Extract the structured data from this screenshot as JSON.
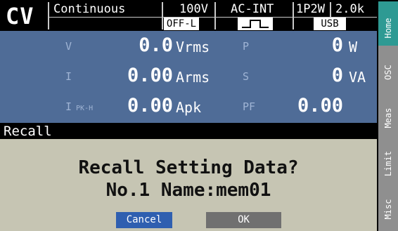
{
  "status_bar": {
    "mode": "CV",
    "operation": "Continuous",
    "range": "100V",
    "signal_source": "AC-INT",
    "phase_wire": "1P2W",
    "current_range": "2.0k",
    "output": "OFF-L",
    "waveform_icon": "square-wave-icon",
    "interface": "USB"
  },
  "measurements": [
    {
      "label": "V",
      "sublabel": "",
      "value": "0.0",
      "unit": "Vrms",
      "label2": "P",
      "value2": "0",
      "unit2": "W"
    },
    {
      "label": "I",
      "sublabel": "",
      "value": "0.00",
      "unit": "Arms",
      "label2": "S",
      "value2": "0",
      "unit2": "VA"
    },
    {
      "label": "I",
      "sublabel": "PK-H",
      "value": "0.00",
      "unit": "Apk",
      "label2": "PF",
      "value2": "0.00",
      "unit2": ""
    }
  ],
  "dialog": {
    "title": "Recall",
    "question": "Recall Setting Data?",
    "detail": "No.1 Name:mem01",
    "cancel_label": "Cancel",
    "ok_label": "OK"
  },
  "softkeys": [
    {
      "label": "Home",
      "active": true
    },
    {
      "label": "OSC",
      "active": false
    },
    {
      "label": "Meas",
      "active": false
    },
    {
      "label": "Limit",
      "active": false
    },
    {
      "label": "Misc",
      "active": false
    }
  ],
  "colors": {
    "measurement_panel": "#4f6c97",
    "dialog_bg": "#c6c5b3",
    "active_softkey": "#2e9a93",
    "cancel_button": "#2f5fb0",
    "ok_button": "#707070"
  }
}
